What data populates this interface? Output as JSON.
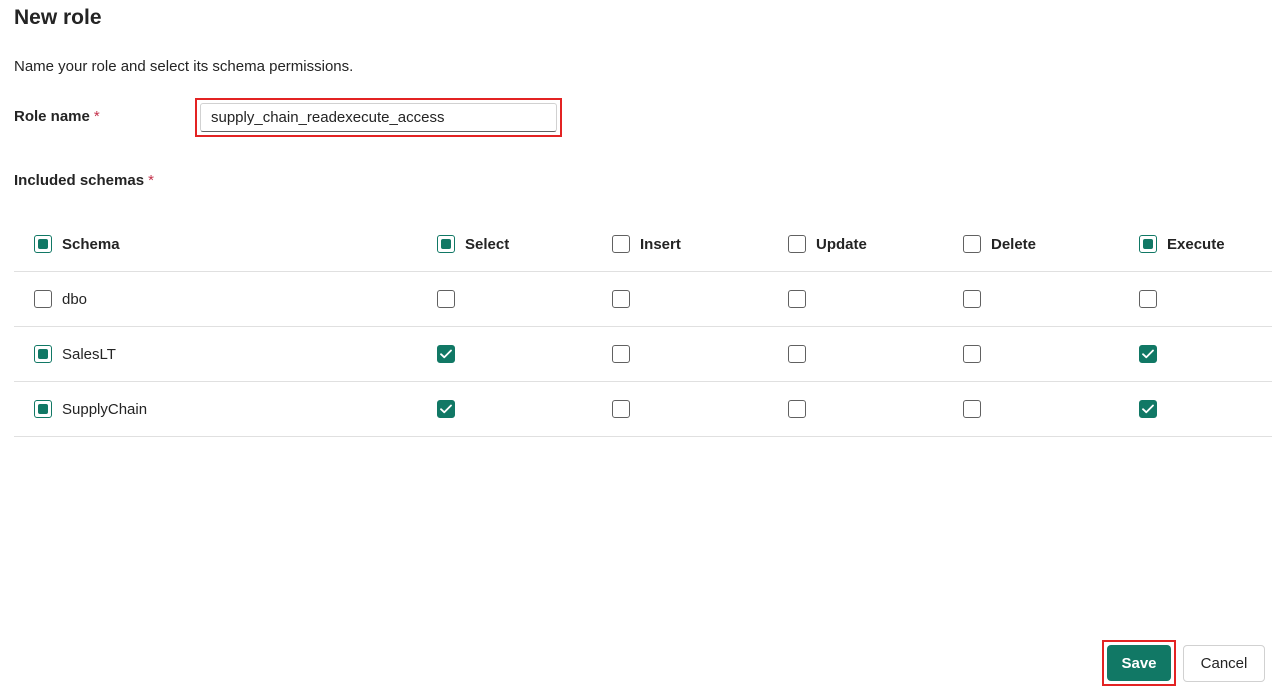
{
  "dialog": {
    "title": "New role",
    "subtitle": "Name your role and select its schema permissions."
  },
  "form": {
    "role_name_label": "Role name",
    "required_marker": "*",
    "role_name_value": "supply_chain_readexecute_access",
    "included_schemas_label": "Included schemas"
  },
  "table": {
    "columns": [
      {
        "label": "Schema",
        "state": "mixed"
      },
      {
        "label": "Select",
        "state": "mixed"
      },
      {
        "label": "Insert",
        "state": "unchecked"
      },
      {
        "label": "Update",
        "state": "unchecked"
      },
      {
        "label": "Delete",
        "state": "unchecked"
      },
      {
        "label": "Execute",
        "state": "mixed"
      }
    ],
    "rows": [
      {
        "name": "dbo",
        "schema_state": "unchecked",
        "perms": [
          false,
          false,
          false,
          false,
          false
        ]
      },
      {
        "name": "SalesLT",
        "schema_state": "mixed",
        "perms": [
          true,
          false,
          false,
          false,
          true
        ]
      },
      {
        "name": "SupplyChain",
        "schema_state": "mixed",
        "perms": [
          true,
          false,
          false,
          false,
          true
        ]
      }
    ]
  },
  "actions": {
    "save_label": "Save",
    "cancel_label": "Cancel"
  },
  "colors": {
    "accent": "#117865",
    "highlight": "#e32323",
    "required": "#c4314b"
  }
}
